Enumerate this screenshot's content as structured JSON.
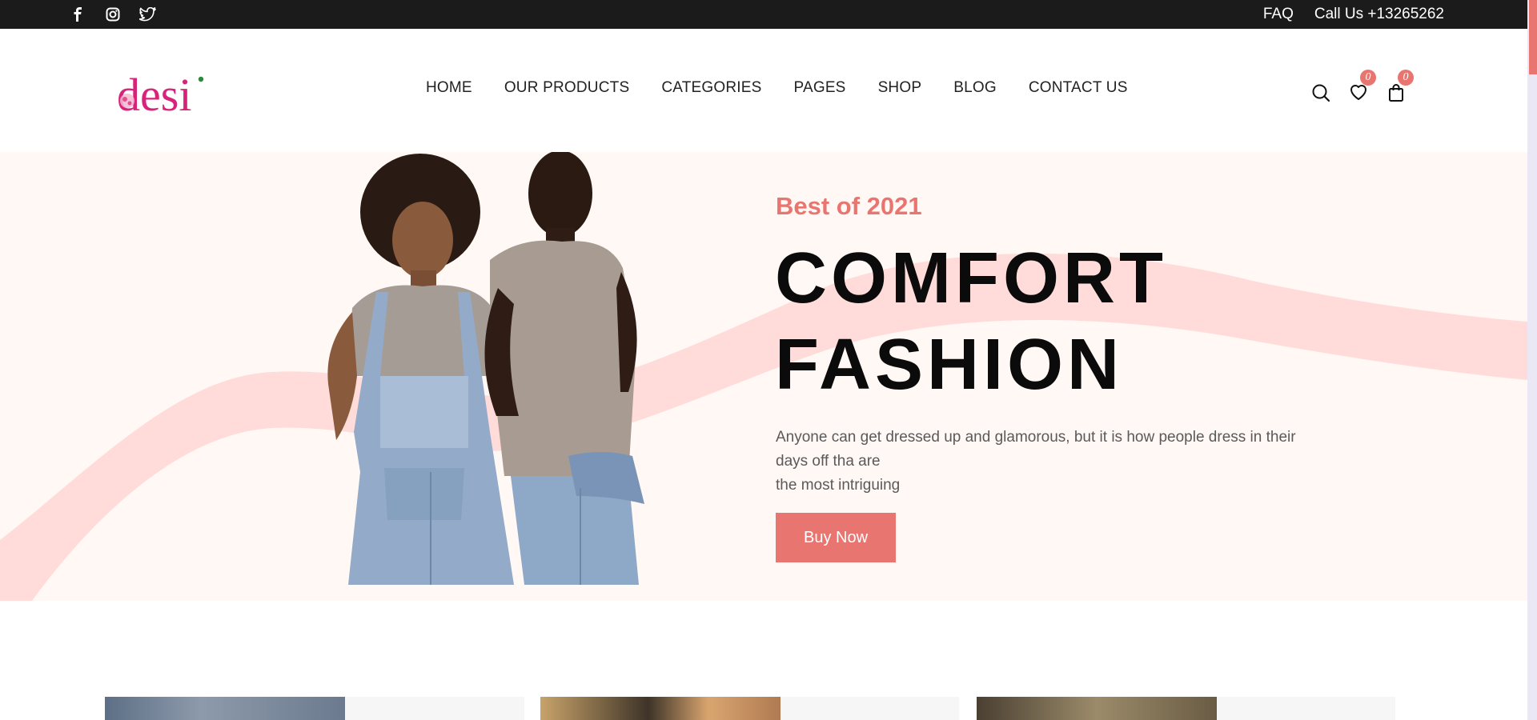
{
  "topbar": {
    "social_icons": [
      "facebook-icon",
      "instagram-icon",
      "twitter-icon"
    ],
    "faq_label": "FAQ",
    "call_label": "Call Us +13265262"
  },
  "header": {
    "logo_text": "desi",
    "nav": [
      {
        "label": "HOME"
      },
      {
        "label": "OUR PRODUCTS"
      },
      {
        "label": "CATEGORIES"
      },
      {
        "label": "PAGES"
      },
      {
        "label": "SHOP"
      },
      {
        "label": "BLOG"
      },
      {
        "label": "CONTACT US"
      }
    ],
    "icons": [
      "search-icon",
      "heart-icon",
      "shopping-bag-icon"
    ],
    "wishlist_count": "0",
    "cart_count": "0"
  },
  "hero": {
    "subtitle": "Best of 2021",
    "title_line1": "COMFORT",
    "title_line2": "FASHION",
    "desc_line1": "Anyone can get dressed up and glamorous, but it is how people dress in their days off tha are",
    "desc_line2": "the most intriguing",
    "button_label": "Buy Now"
  },
  "colors": {
    "accent": "#e87570",
    "logo": "#d7247a",
    "topbar_bg": "#1b1b1b",
    "hero_bg": "#fff8f5",
    "wave": "#ffdcda"
  }
}
